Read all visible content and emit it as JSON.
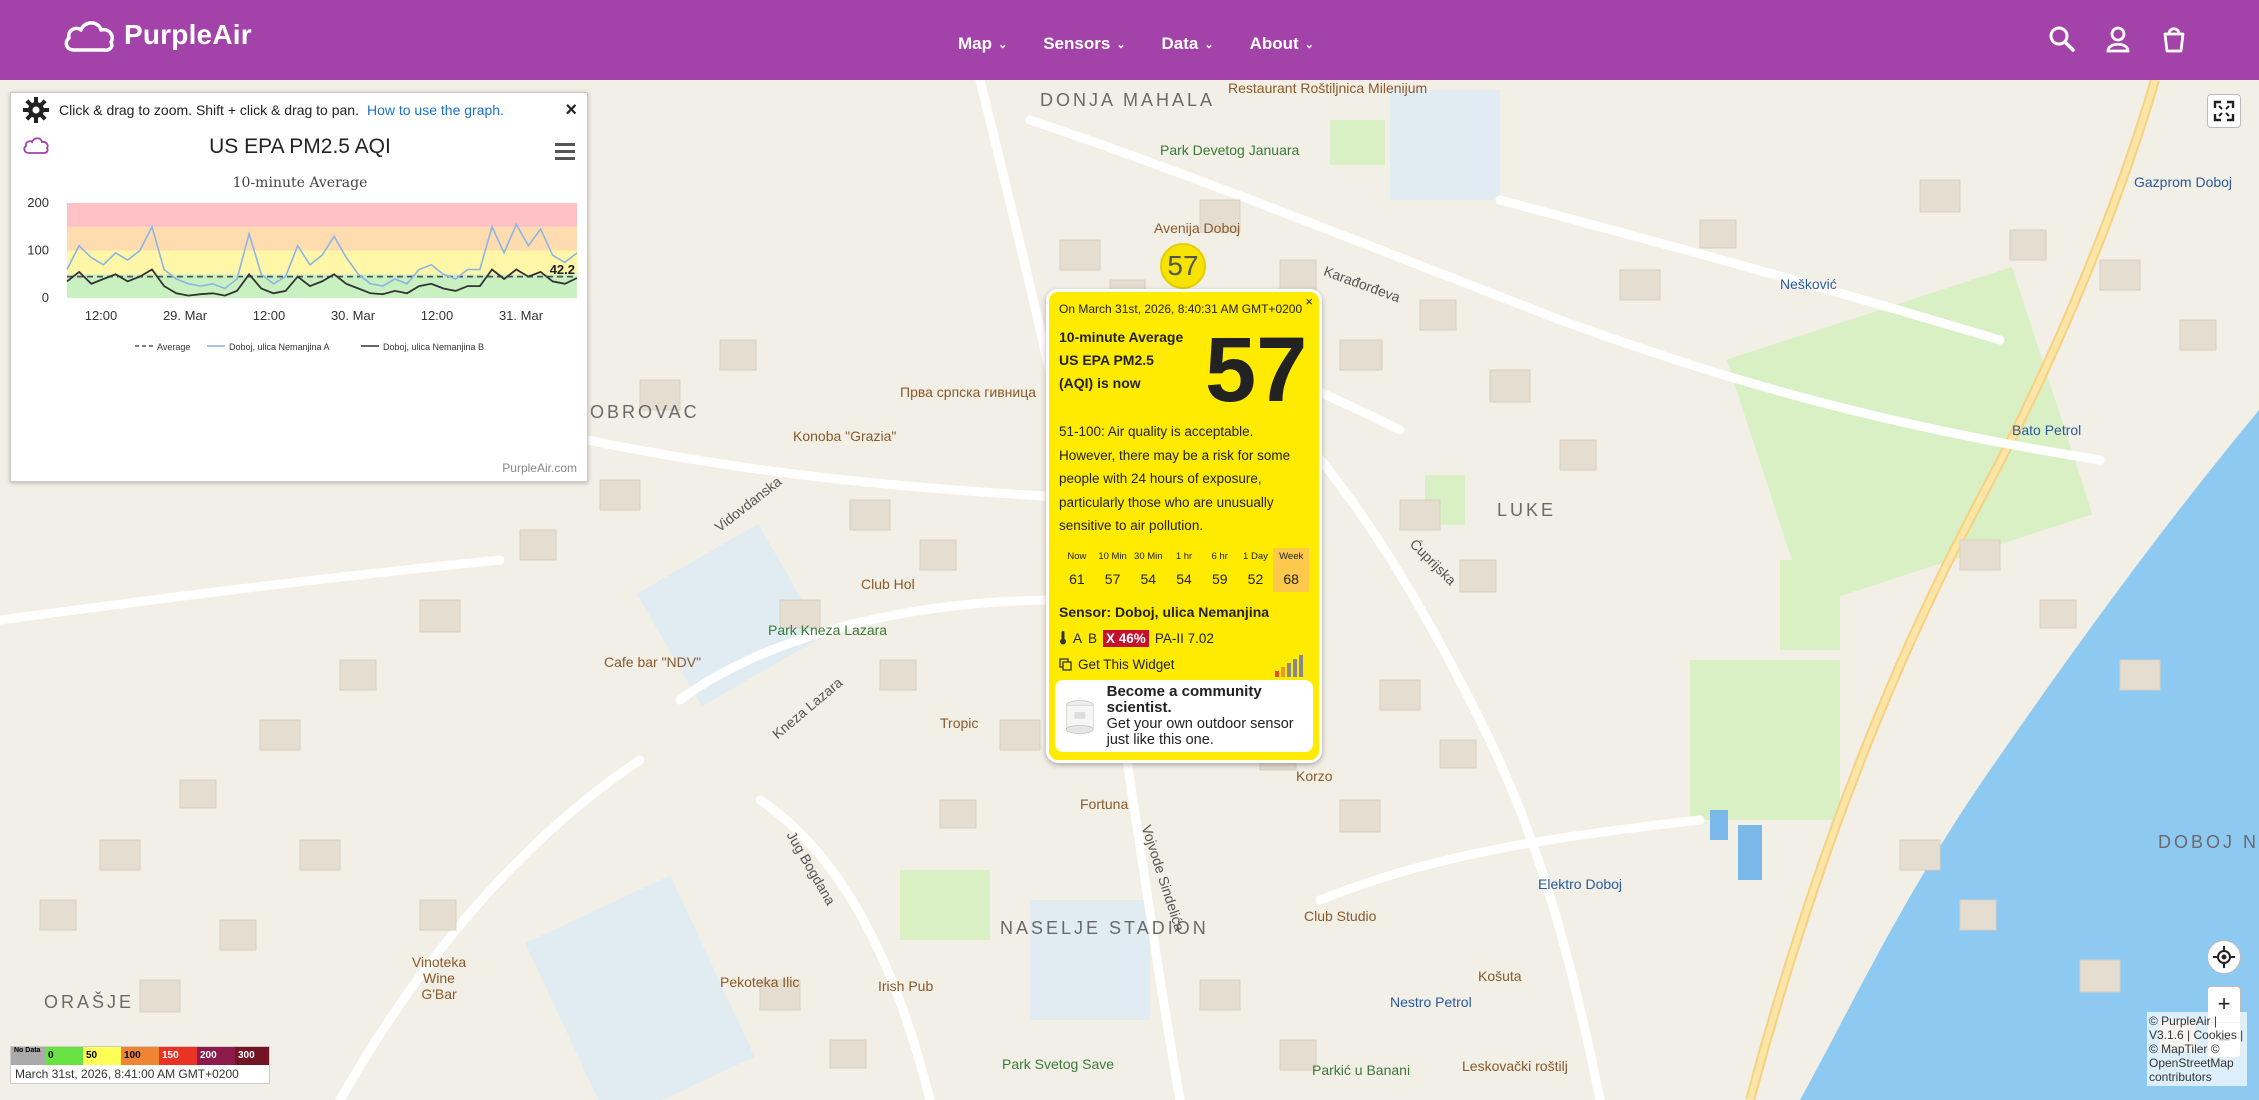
{
  "navbar": {
    "brand": "PurpleAir",
    "menu": [
      {
        "label": "Map"
      },
      {
        "label": "Sensors"
      },
      {
        "label": "Data"
      },
      {
        "label": "About"
      }
    ],
    "icons": [
      "search-icon",
      "user-icon",
      "cart-icon"
    ]
  },
  "graph": {
    "hint": "Click & drag to zoom. Shift + click & drag to pan.",
    "hint_link": "How to use the graph.",
    "close": "×",
    "title": "US EPA PM2.5 AQI",
    "subtitle": "10-minute Average",
    "credit": "PurpleAir.com",
    "y_ticks": [
      "200",
      "100",
      "0"
    ],
    "x_ticks": [
      "12:00",
      "29. Mar",
      "12:00",
      "30. Mar",
      "12:00",
      "31. Mar"
    ],
    "last_value": "42.2",
    "legend": [
      "Average",
      "Doboj, ulica Nemanjina A",
      "Doboj, ulica Nemanjina B"
    ]
  },
  "chart_data": {
    "type": "line",
    "title": "US EPA PM2.5 AQI",
    "subtitle": "10-minute Average",
    "ylim": [
      0,
      200
    ],
    "y_ticks": [
      0,
      100,
      200
    ],
    "x_ticks": [
      "12:00",
      "29. Mar",
      "12:00",
      "30. Mar",
      "12:00",
      "31. Mar"
    ],
    "bands": [
      {
        "from": 0,
        "to": 50,
        "color": "#c8f0c0"
      },
      {
        "from": 50,
        "to": 100,
        "color": "#fff6a8"
      },
      {
        "from": 100,
        "to": 150,
        "color": "#ffdcb0"
      },
      {
        "from": 150,
        "to": 200,
        "color": "#ffc0c6"
      }
    ],
    "series": [
      {
        "name": "Average",
        "color": "#555555",
        "style": "dashed",
        "values": [
          45,
          45,
          45,
          45,
          45,
          45,
          45,
          45,
          45,
          45,
          45,
          45,
          45,
          45,
          45,
          45,
          45,
          45,
          45,
          45,
          45,
          45,
          45,
          45,
          45,
          45,
          45,
          45,
          45,
          45,
          45,
          45,
          45,
          45,
          45,
          45,
          45,
          45,
          45,
          45,
          45,
          45,
          45
        ]
      },
      {
        "name": "Doboj, ulica Nemanjina A",
        "color": "#8cb4e6",
        "style": "solid",
        "values": [
          60,
          110,
          85,
          70,
          95,
          80,
          100,
          150,
          60,
          40,
          30,
          25,
          30,
          20,
          40,
          135,
          50,
          30,
          45,
          110,
          70,
          90,
          130,
          85,
          50,
          30,
          25,
          40,
          30,
          60,
          70,
          50,
          40,
          60,
          60,
          150,
          95,
          155,
          110,
          145,
          90,
          75,
          95
        ]
      },
      {
        "name": "Doboj, ulica Nemanjina B",
        "color": "#333333",
        "style": "solid",
        "values": [
          35,
          55,
          30,
          40,
          50,
          35,
          45,
          60,
          25,
          10,
          5,
          8,
          10,
          5,
          15,
          50,
          20,
          10,
          15,
          45,
          25,
          35,
          50,
          30,
          20,
          10,
          8,
          15,
          10,
          25,
          30,
          20,
          15,
          25,
          25,
          60,
          40,
          60,
          45,
          55,
          35,
          30,
          42
        ]
      }
    ]
  },
  "popup": {
    "marker_value": "57",
    "close": "×",
    "timestamp": "On March 31st, 2026, 8:40:31 AM GMT+0200",
    "head_line1": "10-minute Average",
    "head_line2": "US EPA PM2.5",
    "head_line3": "(AQI) is now",
    "aqi": "57",
    "description": "51-100: Air quality is acceptable. However, there may be a risk for some people with 24 hours of exposure, particularly those who are unusually sensitive to air pollution.",
    "history": [
      {
        "label": "Now",
        "value": "61"
      },
      {
        "label": "10 Min",
        "value": "57"
      },
      {
        "label": "30 Min",
        "value": "54"
      },
      {
        "label": "1 hr",
        "value": "54"
      },
      {
        "label": "6 hr",
        "value": "59"
      },
      {
        "label": "1 Day",
        "value": "52"
      },
      {
        "label": "Week",
        "value": "68"
      }
    ],
    "sensor": "Sensor: Doboj, ulica Nemanjina",
    "channel_a": "A",
    "channel_b": "B",
    "humidity": "X 46%",
    "model": "PA-II 7.02",
    "widget": "Get This Widget",
    "promo_title": "Become a community scientist.",
    "promo_text": "Get your own outdoor sensor just like this one."
  },
  "map": {
    "areas": [
      "DONJA MAHALA",
      "LUKE",
      "NASELJE STADION",
      "ORAŠJE",
      "DOBOJ NO",
      "OBROVAC"
    ],
    "pois": [
      "Restaurant Roštiljnica Milenijum",
      "Park Devetog Januara",
      "Avenija Doboj",
      "Gazprom Doboj",
      "Nešković",
      "Bato Petrol",
      "Прва српска гивница",
      "Konoba \"Grazia\"",
      "Club Hol",
      "Park Kneza Lazara",
      "Cafe bar \"NDV\"",
      "Tropic",
      "Fortuna",
      "Korzo",
      "Club Studio",
      "Irish Pub",
      "Pekoteka Ilic",
      "Vinoteka Wine G'Bar",
      "Park Svetog Save",
      "Parkić u Banani",
      "Leskovački roštilj",
      "Košuta",
      "Nestro Petrol",
      "Elektro Doboj"
    ],
    "streets": [
      "Karađorđeva",
      "Vidovdanska",
      "Kneza Lazara",
      "Jug Bogdana",
      "Vojvode Sindelića",
      "Ćuprijska"
    ],
    "attribution": "© PurpleAir | V3.1.6 | Cookies | © MapTiler © OpenStreetMap contributors"
  },
  "legend": {
    "items": [
      {
        "label": "No Data",
        "color": "#aaaaaa"
      },
      {
        "label": "0",
        "color": "#68e143"
      },
      {
        "label": "50",
        "color": "#ffff55"
      },
      {
        "label": "100",
        "color": "#ef8533"
      },
      {
        "label": "150",
        "color": "#ea3324"
      },
      {
        "label": "200",
        "color": "#8c1a4b"
      },
      {
        "label": "300",
        "color": "#731425"
      }
    ],
    "timestamp": "March 31st, 2026, 8:41:00 AM GMT+0200"
  },
  "controls": {
    "zoom_in": "+",
    "zoom_out": "−"
  }
}
